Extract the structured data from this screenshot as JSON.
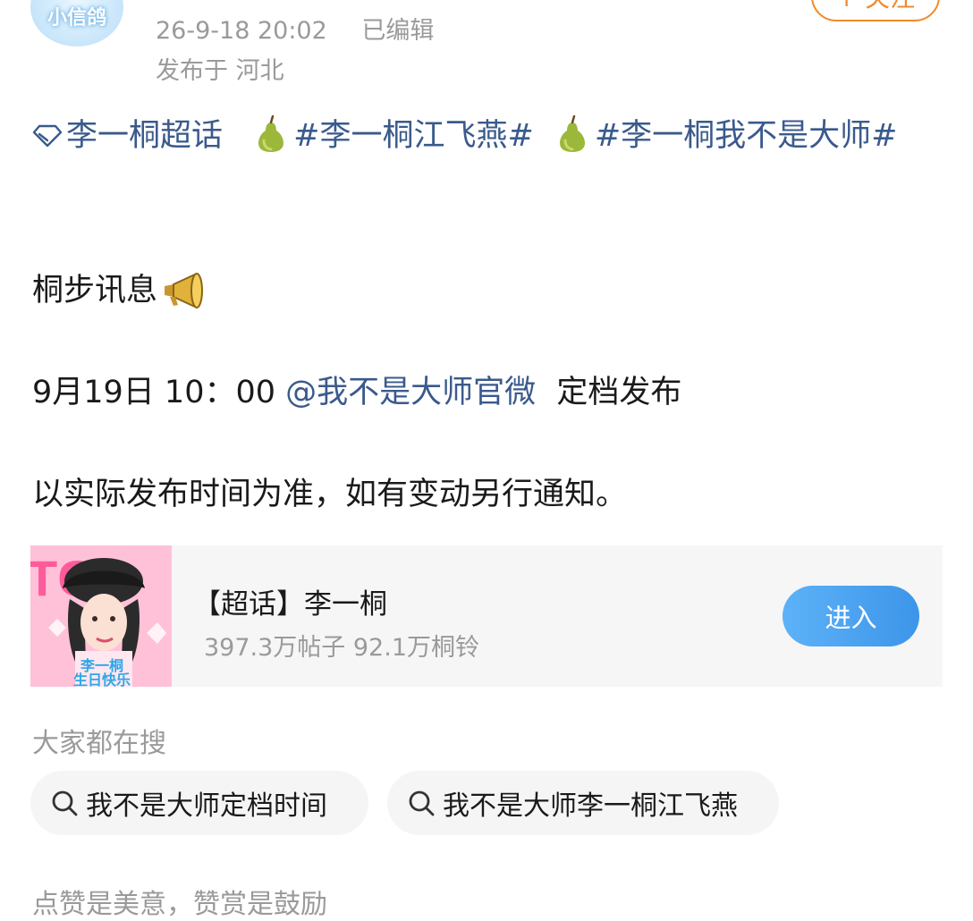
{
  "header": {
    "avatar_text": "小信鸽",
    "timestamp": "26-9-18 20:02",
    "edited_label": "已编辑",
    "location": "发布于 河北",
    "follow_label": "+ 关注"
  },
  "post": {
    "super_topic_link": "李一桐超话",
    "hashtag_1": "#李一桐江飞燕#",
    "hashtag_2": "#李一桐我不是大师#",
    "line_1": "桐步讯息",
    "line_2_time": "9月19日 10：00",
    "line_2_mention": "@我不是大师官微",
    "line_2_tail": "定档发布",
    "line_3": "以实际发布时间为准，如有变动另行通知。"
  },
  "card": {
    "title": "【超话】李一桐",
    "stats": "397.3万帖子 92.1万桐铃",
    "enter_label": "进入",
    "image_caption": "李一桐 生日快乐"
  },
  "searches": {
    "heading": "大家都在搜",
    "items": [
      "我不是大师定档时间",
      "我不是大师李一桐江飞燕"
    ]
  },
  "footer": {
    "partial_text": "点赞是美意，赞赏是鼓励"
  },
  "colors": {
    "link": "#3a5a8c",
    "meta": "#9a9a9a",
    "accent_orange": "#f08b2e",
    "button_blue": "#3d95ea"
  }
}
